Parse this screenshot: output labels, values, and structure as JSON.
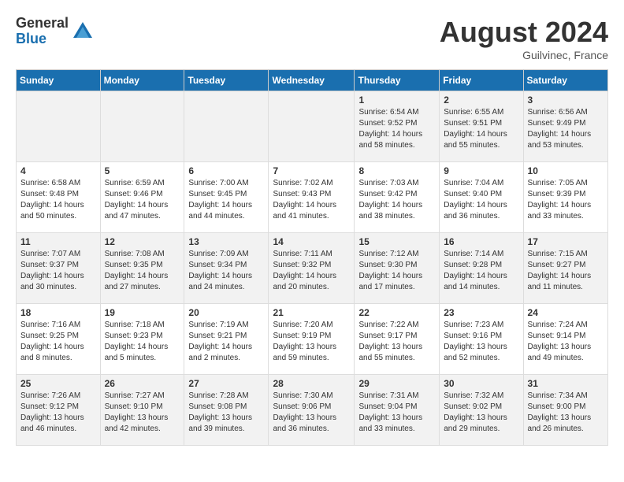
{
  "header": {
    "logo_general": "General",
    "logo_blue": "Blue",
    "month_year": "August 2024",
    "location": "Guilvinec, France"
  },
  "days_of_week": [
    "Sunday",
    "Monday",
    "Tuesday",
    "Wednesday",
    "Thursday",
    "Friday",
    "Saturday"
  ],
  "weeks": [
    [
      {
        "day": "",
        "info": ""
      },
      {
        "day": "",
        "info": ""
      },
      {
        "day": "",
        "info": ""
      },
      {
        "day": "",
        "info": ""
      },
      {
        "day": "1",
        "info": "Sunrise: 6:54 AM\nSunset: 9:52 PM\nDaylight: 14 hours\nand 58 minutes."
      },
      {
        "day": "2",
        "info": "Sunrise: 6:55 AM\nSunset: 9:51 PM\nDaylight: 14 hours\nand 55 minutes."
      },
      {
        "day": "3",
        "info": "Sunrise: 6:56 AM\nSunset: 9:49 PM\nDaylight: 14 hours\nand 53 minutes."
      }
    ],
    [
      {
        "day": "4",
        "info": "Sunrise: 6:58 AM\nSunset: 9:48 PM\nDaylight: 14 hours\nand 50 minutes."
      },
      {
        "day": "5",
        "info": "Sunrise: 6:59 AM\nSunset: 9:46 PM\nDaylight: 14 hours\nand 47 minutes."
      },
      {
        "day": "6",
        "info": "Sunrise: 7:00 AM\nSunset: 9:45 PM\nDaylight: 14 hours\nand 44 minutes."
      },
      {
        "day": "7",
        "info": "Sunrise: 7:02 AM\nSunset: 9:43 PM\nDaylight: 14 hours\nand 41 minutes."
      },
      {
        "day": "8",
        "info": "Sunrise: 7:03 AM\nSunset: 9:42 PM\nDaylight: 14 hours\nand 38 minutes."
      },
      {
        "day": "9",
        "info": "Sunrise: 7:04 AM\nSunset: 9:40 PM\nDaylight: 14 hours\nand 36 minutes."
      },
      {
        "day": "10",
        "info": "Sunrise: 7:05 AM\nSunset: 9:39 PM\nDaylight: 14 hours\nand 33 minutes."
      }
    ],
    [
      {
        "day": "11",
        "info": "Sunrise: 7:07 AM\nSunset: 9:37 PM\nDaylight: 14 hours\nand 30 minutes."
      },
      {
        "day": "12",
        "info": "Sunrise: 7:08 AM\nSunset: 9:35 PM\nDaylight: 14 hours\nand 27 minutes."
      },
      {
        "day": "13",
        "info": "Sunrise: 7:09 AM\nSunset: 9:34 PM\nDaylight: 14 hours\nand 24 minutes."
      },
      {
        "day": "14",
        "info": "Sunrise: 7:11 AM\nSunset: 9:32 PM\nDaylight: 14 hours\nand 20 minutes."
      },
      {
        "day": "15",
        "info": "Sunrise: 7:12 AM\nSunset: 9:30 PM\nDaylight: 14 hours\nand 17 minutes."
      },
      {
        "day": "16",
        "info": "Sunrise: 7:14 AM\nSunset: 9:28 PM\nDaylight: 14 hours\nand 14 minutes."
      },
      {
        "day": "17",
        "info": "Sunrise: 7:15 AM\nSunset: 9:27 PM\nDaylight: 14 hours\nand 11 minutes."
      }
    ],
    [
      {
        "day": "18",
        "info": "Sunrise: 7:16 AM\nSunset: 9:25 PM\nDaylight: 14 hours\nand 8 minutes."
      },
      {
        "day": "19",
        "info": "Sunrise: 7:18 AM\nSunset: 9:23 PM\nDaylight: 14 hours\nand 5 minutes."
      },
      {
        "day": "20",
        "info": "Sunrise: 7:19 AM\nSunset: 9:21 PM\nDaylight: 14 hours\nand 2 minutes."
      },
      {
        "day": "21",
        "info": "Sunrise: 7:20 AM\nSunset: 9:19 PM\nDaylight: 13 hours\nand 59 minutes."
      },
      {
        "day": "22",
        "info": "Sunrise: 7:22 AM\nSunset: 9:17 PM\nDaylight: 13 hours\nand 55 minutes."
      },
      {
        "day": "23",
        "info": "Sunrise: 7:23 AM\nSunset: 9:16 PM\nDaylight: 13 hours\nand 52 minutes."
      },
      {
        "day": "24",
        "info": "Sunrise: 7:24 AM\nSunset: 9:14 PM\nDaylight: 13 hours\nand 49 minutes."
      }
    ],
    [
      {
        "day": "25",
        "info": "Sunrise: 7:26 AM\nSunset: 9:12 PM\nDaylight: 13 hours\nand 46 minutes."
      },
      {
        "day": "26",
        "info": "Sunrise: 7:27 AM\nSunset: 9:10 PM\nDaylight: 13 hours\nand 42 minutes."
      },
      {
        "day": "27",
        "info": "Sunrise: 7:28 AM\nSunset: 9:08 PM\nDaylight: 13 hours\nand 39 minutes."
      },
      {
        "day": "28",
        "info": "Sunrise: 7:30 AM\nSunset: 9:06 PM\nDaylight: 13 hours\nand 36 minutes."
      },
      {
        "day": "29",
        "info": "Sunrise: 7:31 AM\nSunset: 9:04 PM\nDaylight: 13 hours\nand 33 minutes."
      },
      {
        "day": "30",
        "info": "Sunrise: 7:32 AM\nSunset: 9:02 PM\nDaylight: 13 hours\nand 29 minutes."
      },
      {
        "day": "31",
        "info": "Sunrise: 7:34 AM\nSunset: 9:00 PM\nDaylight: 13 hours\nand 26 minutes."
      }
    ]
  ]
}
